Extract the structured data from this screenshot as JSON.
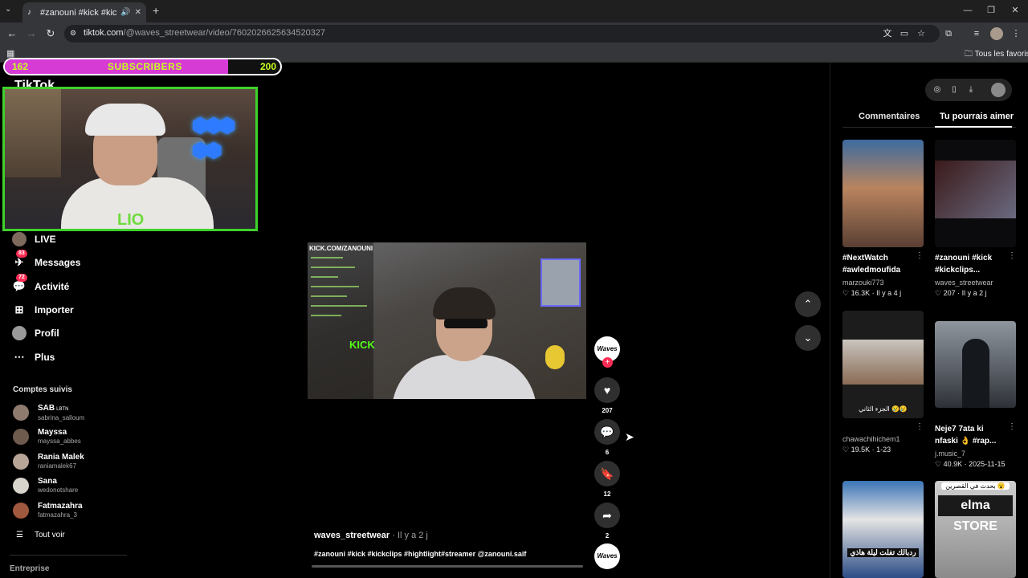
{
  "browser": {
    "tab_title": "#zanouni #kick #kickclips #",
    "url_host": "tiktok.com",
    "url_path": "/@waves_streetwear/video/7602026625634520327",
    "bookmarks_all": "Tous les favoris"
  },
  "overlay": {
    "sub_current": "162",
    "sub_label": "SUBSCRIBERS",
    "sub_goal": "200",
    "sub_progress": 0.81,
    "brand_partial": "TikTok",
    "cam_signature": "LIO"
  },
  "sidebar": {
    "nav": [
      {
        "label": "LIVE",
        "icon": "live-icon"
      },
      {
        "label": "Messages",
        "icon": "messages-icon",
        "badge": "83"
      },
      {
        "label": "Activité",
        "icon": "activity-icon",
        "badge": "72"
      },
      {
        "label": "Importer",
        "icon": "upload-icon"
      },
      {
        "label": "Profil",
        "icon": "profile-icon"
      },
      {
        "label": "Plus",
        "icon": "more-icon"
      }
    ],
    "following_title": "Comptes suivis",
    "following": [
      {
        "name": "SAB",
        "tag": "LBTN",
        "handle": "sabrina_salloum"
      },
      {
        "name": "Mayssa",
        "handle": "mayssa_abbes"
      },
      {
        "name": "Rania Malek",
        "handle": "raniamalek67"
      },
      {
        "name": "Sana",
        "handle": "wedonotshare"
      },
      {
        "name": "Fatmazahra",
        "handle": "fatmazahra_3"
      }
    ],
    "see_all": "Tout voir",
    "footer": "Entreprise"
  },
  "video": {
    "chat_header": "KICK.COM/ZANOUNI",
    "kick_sign": "KICK",
    "author": "waves_streetwear",
    "time": " · Il y a 2 j",
    "description": "#zanouni #kick #kickclips #hightlight#streamer  @zanouni.saif",
    "avatar_text": "Waves",
    "likes": "207",
    "comments": "6",
    "saves": "12",
    "shares": "2"
  },
  "right_panel": {
    "tab_comments": "Commentaires",
    "tab_recommend": "Tu pourrais aimer",
    "cards": [
      {
        "title": "#NextWatch #awledmoufida",
        "user": "marzouki773",
        "likes": "16.3K",
        "date": "Il y a 4 j"
      },
      {
        "title": "#zanouni #kick #kickclips...",
        "user": "waves_streetwear",
        "likes": "207",
        "date": "Il y a 2 j"
      },
      {
        "title": "",
        "user": "chawachihichem1",
        "likes": "19.5K",
        "date": "1-23",
        "caption": "الجزء الثاني 😢😢"
      },
      {
        "title": "Neje7 7ata ki nfaski 👌 #rap...",
        "user": "j.music_7",
        "likes": "40.9K",
        "date": "2025-11-15"
      },
      {
        "title": "",
        "caption": "ردبالك تفلت ليلة هاذي"
      },
      {
        "title": "",
        "caption": "بحدث في القصرين 😮",
        "sign": "elma STORE"
      }
    ]
  }
}
